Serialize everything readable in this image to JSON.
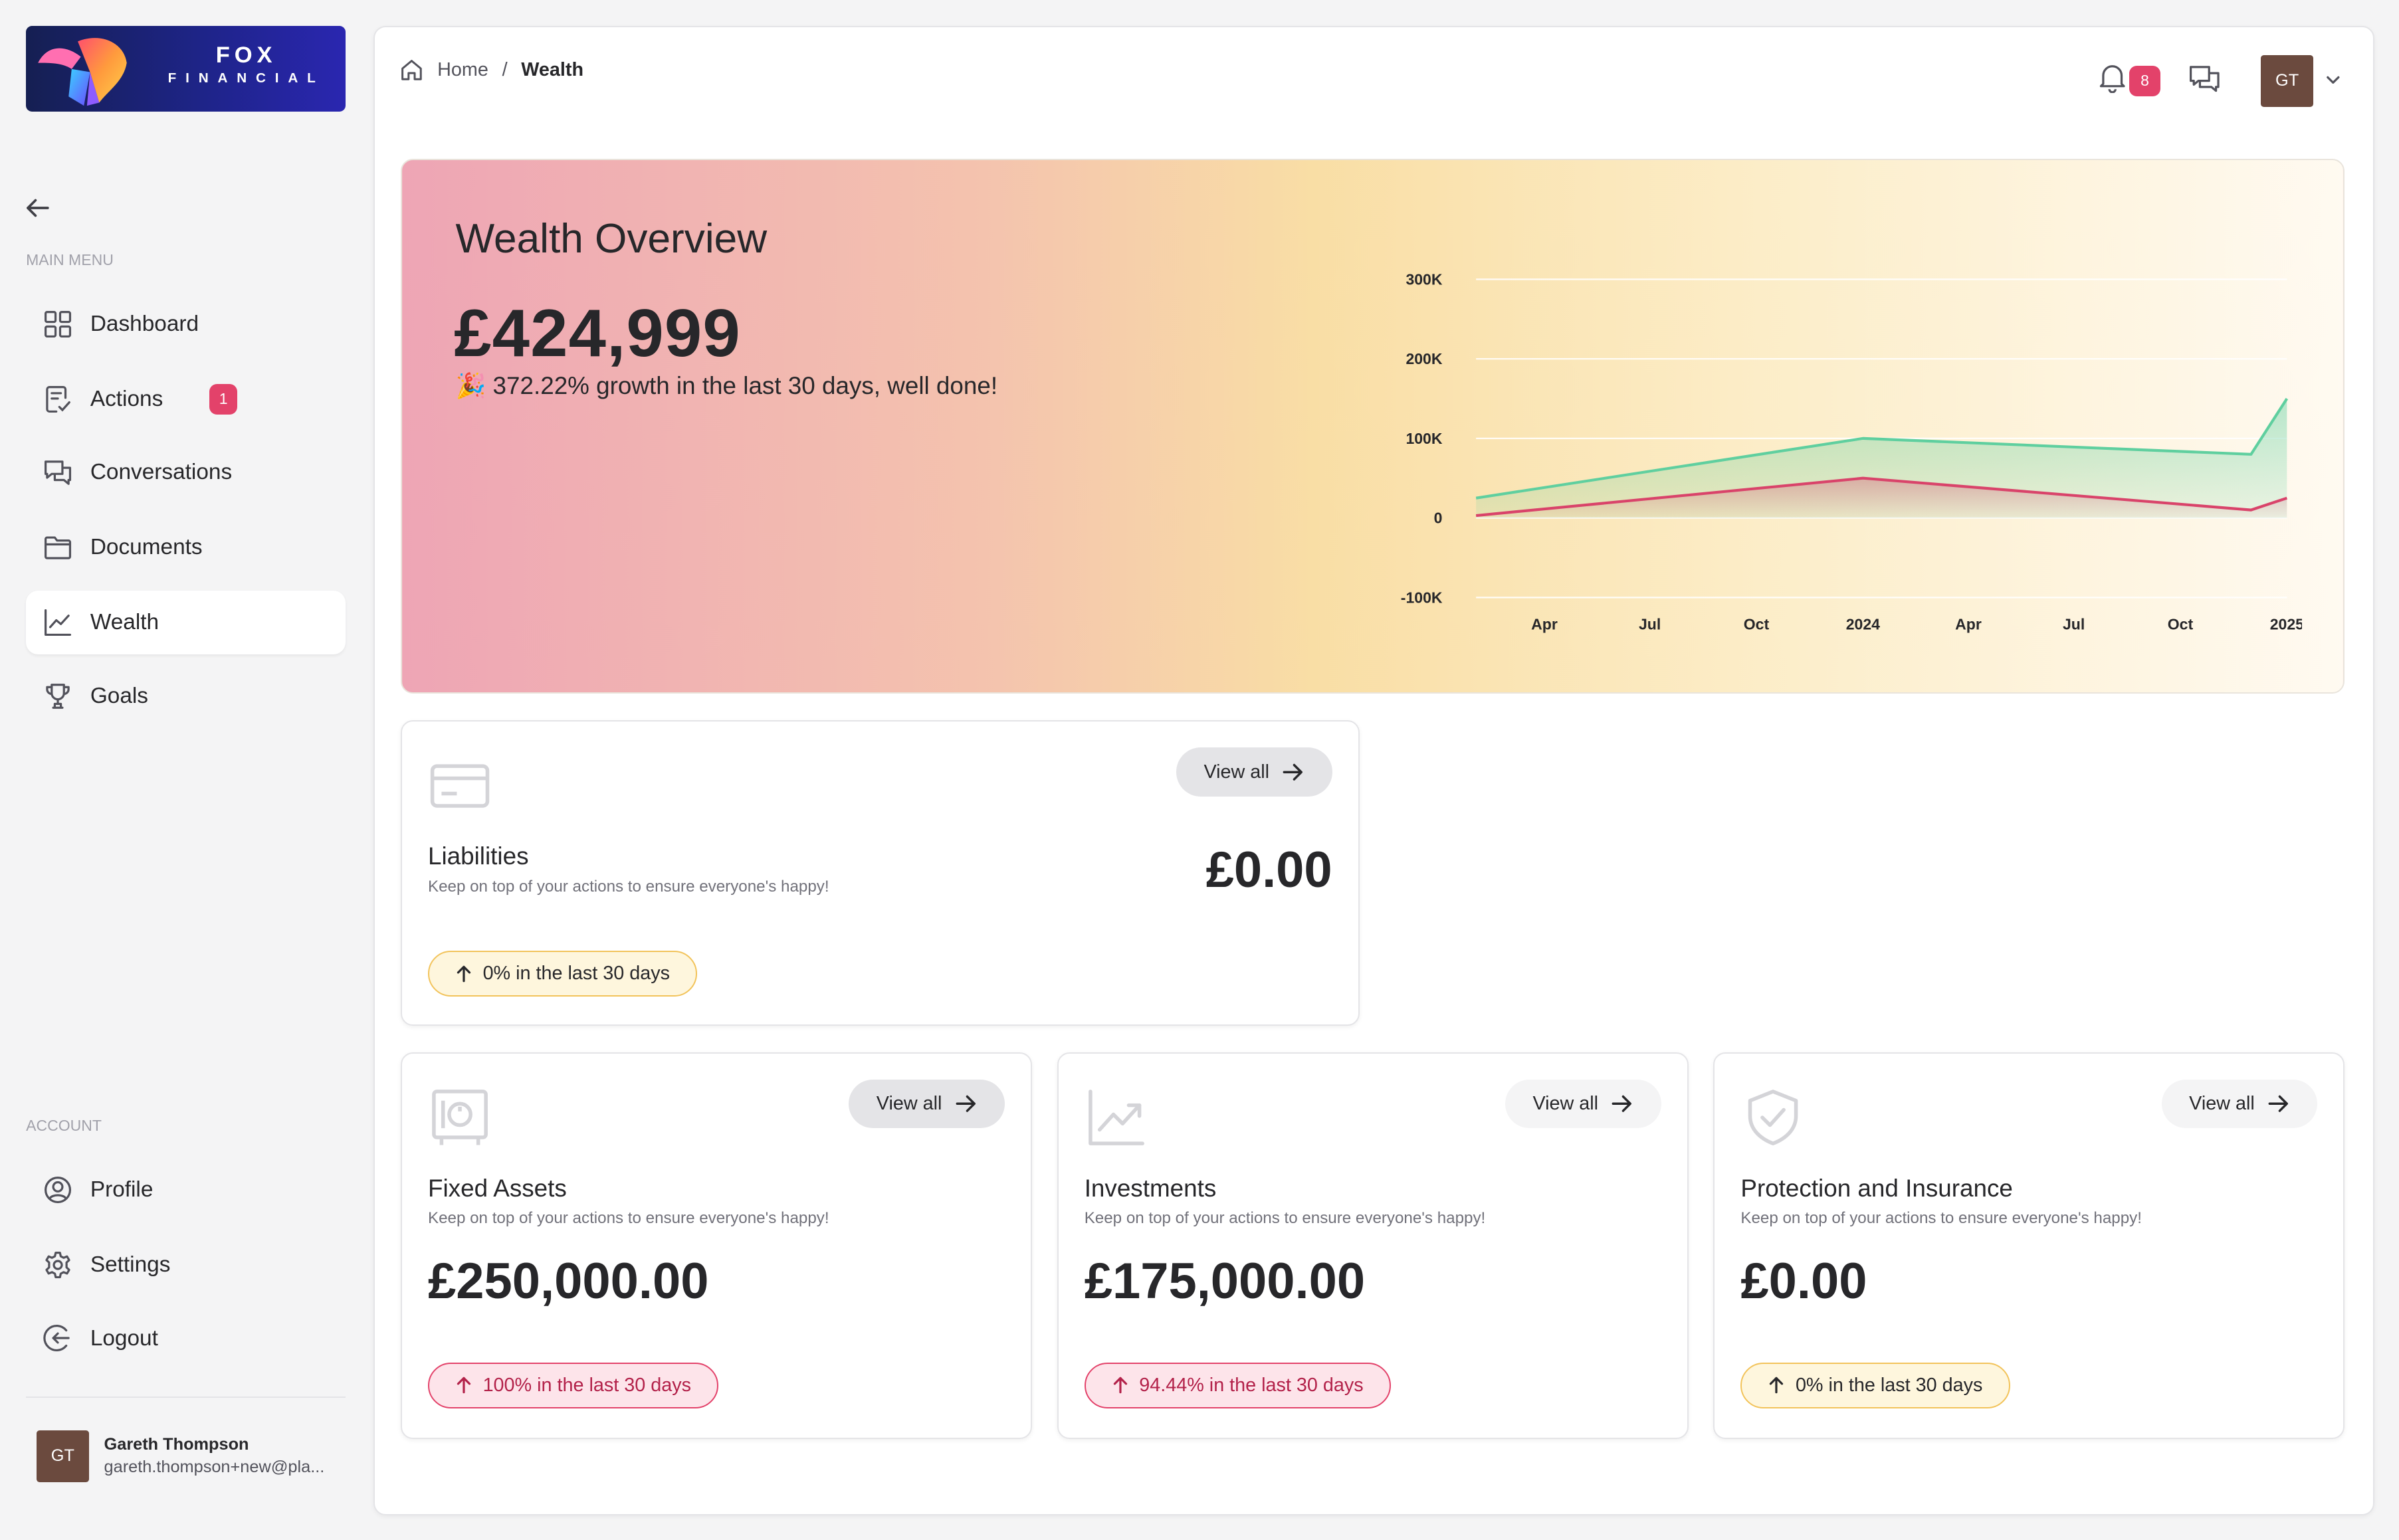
{
  "brand": {
    "name": "FOX",
    "sub": "FINANCIAL"
  },
  "sidebar": {
    "main_menu_label": "MAIN MENU",
    "items": [
      {
        "label": "Dashboard",
        "icon": "grid-icon"
      },
      {
        "label": "Actions",
        "icon": "clipboard-icon",
        "badge": "1"
      },
      {
        "label": "Conversations",
        "icon": "chat-icon"
      },
      {
        "label": "Documents",
        "icon": "folder-icon"
      },
      {
        "label": "Wealth",
        "icon": "chart-line-icon",
        "active": true
      },
      {
        "label": "Goals",
        "icon": "trophy-icon"
      }
    ],
    "account_label": "ACCOUNT",
    "account_items": [
      {
        "label": "Profile",
        "icon": "user-circle-icon"
      },
      {
        "label": "Settings",
        "icon": "gear-icon"
      },
      {
        "label": "Logout",
        "icon": "logout-icon"
      }
    ],
    "user": {
      "initials": "GT",
      "name": "Gareth Thompson",
      "email": "gareth.thompson+new@pla..."
    }
  },
  "header": {
    "breadcrumb": {
      "home": "Home",
      "separator": "/",
      "current": "Wealth"
    },
    "notifications_count": "8",
    "avatar_initials": "GT"
  },
  "hero": {
    "title": "Wealth Overview",
    "value": "£424,999",
    "growth": "🎉 372.22% growth in the last 30 days, well done!"
  },
  "chart_data": {
    "type": "area",
    "x_ticks": [
      "Apr",
      "Jul",
      "Oct",
      "2024",
      "Apr",
      "Jul",
      "Oct",
      "2025"
    ],
    "y_ticks": [
      "300K",
      "200K",
      "100K",
      "0",
      "-100K"
    ],
    "ylim": [
      -100000,
      300000
    ],
    "grid": true,
    "series": [
      {
        "color": "#5fcf9f",
        "points": [
          [
            "2023-02-01",
            25000
          ],
          [
            "2024-01-01",
            100000
          ],
          [
            "2024-12-01",
            80000
          ],
          [
            "2025-01-01",
            150000
          ]
        ]
      },
      {
        "color": "#d9436a",
        "points": [
          [
            "2023-02-01",
            3000
          ],
          [
            "2024-01-01",
            50000
          ],
          [
            "2024-12-01",
            10000
          ],
          [
            "2025-01-01",
            25000
          ]
        ]
      }
    ]
  },
  "cards": {
    "view_all": "View all",
    "subtitle": "Keep on top of your actions to ensure everyone's happy!",
    "liabilities": {
      "title": "Liabilities",
      "value": "£0.00",
      "change": "0% in the last 30 days"
    },
    "fixed_assets": {
      "title": "Fixed Assets",
      "value": "£250,000.00",
      "change": "100% in the last 30 days"
    },
    "investments": {
      "title": "Investments",
      "value": "£175,000.00",
      "change": "94.44% in the last 30 days"
    },
    "protection": {
      "title": "Protection and Insurance",
      "value": "£0.00",
      "change": "0% in the last 30 days"
    }
  },
  "colors": {
    "accent_pink": "#e3426a",
    "accent_yellow": "#f2c35a",
    "avatar": "#6b4a3e"
  }
}
